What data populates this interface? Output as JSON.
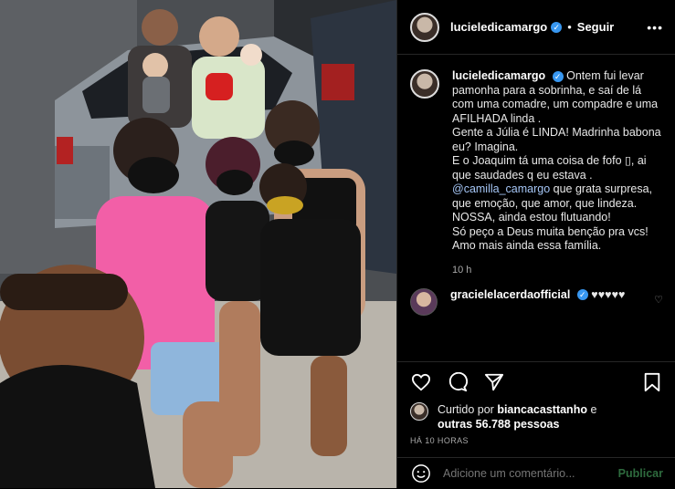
{
  "post": {
    "author": "lucieledicamargo",
    "follow_separator": "•",
    "follow_label": "Seguir",
    "more_icon": "more-horizontal-icon"
  },
  "caption": {
    "author": "lucieledicamargo",
    "text_part1": "Ontem fui levar pamonha para a sobrinha, e saí de lá com uma comadre, um compadre e uma AFILHADA linda .",
    "text_part2": "Gente a Júlia é LINDA! Madrinha babona eu? Imagina.",
    "text_part3": "E o Joaquim tá uma coisa de fofo ▯, ai que saudades q eu estava .",
    "mention": "@camilla_camargo",
    "text_part4": " que grata surpresa, que emoção, que amor, que lindeza.",
    "text_part5": "NOSSA, ainda estou flutuando!",
    "text_part6": "Só peço a Deus muita benção pra vcs!",
    "text_part7": "Amo mais ainda essa família.",
    "time": "10 h"
  },
  "comment": {
    "author": "gracielelacerdaofficial",
    "text": "♥♥♥♥♥"
  },
  "likes": {
    "prefix": "Curtido por",
    "user": "biancacasttanho",
    "joiner": " e",
    "others": "outras 56.788 pessoas"
  },
  "posted_ago": "HÁ 10 HORAS",
  "add_comment": {
    "placeholder": "Adicione um comentário...",
    "publish_label": "Publicar"
  },
  "colors": {
    "verified": "#3897f0",
    "mention": "#a6c7f7",
    "add_comment_text": "#4caf50",
    "publish": "#2e6b3e"
  }
}
